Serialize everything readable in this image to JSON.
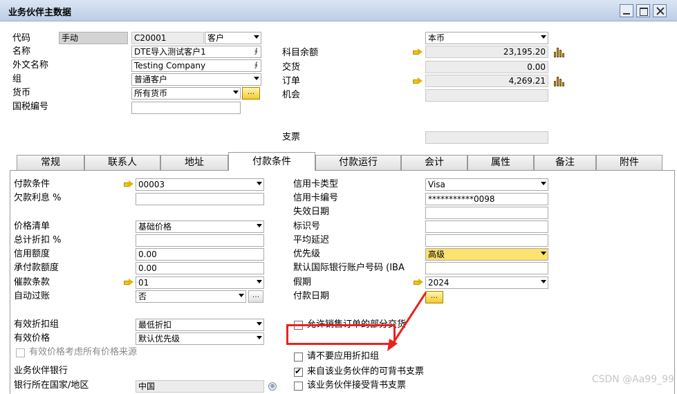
{
  "window": {
    "title": "业务伙伴主数据"
  },
  "header": {
    "code_label": "代码",
    "code_mode": "手动",
    "code_value": "C20001",
    "type_value": "客户",
    "name_label": "名称",
    "name_value": "DTE导入测试客户1",
    "foreign_name_label": "外文名称",
    "foreign_name_value": "Testing Company",
    "group_label": "组",
    "group_value": "普通客户",
    "currency_label": "货币",
    "currency_value": "所有货币",
    "tax_label": "国税编号",
    "tax_value": "",
    "display_currency": "本币",
    "balance_label": "科目余额",
    "balance_value": "23,195.20",
    "delivery_label": "交货",
    "delivery_value": "0.00",
    "orders_label": "订单",
    "orders_value": "4,269.21",
    "opportunity_label": "机会",
    "opportunity_value": "",
    "checks_label": "支票",
    "checks_value": ""
  },
  "tabs": [
    {
      "label": "常规"
    },
    {
      "label": "联系人"
    },
    {
      "label": "地址"
    },
    {
      "label": "付款条件"
    },
    {
      "label": "付款运行"
    },
    {
      "label": "会计"
    },
    {
      "label": "属性"
    },
    {
      "label": "备注"
    },
    {
      "label": "附件"
    }
  ],
  "active_tab": "付款条件",
  "payment": {
    "terms_label": "付款条件",
    "terms_value": "00003",
    "interest_label": "欠款利息 %",
    "interest_value": "",
    "price_list_label": "价格清单",
    "price_list_value": "基础价格",
    "total_discount_label": "总计折扣 %",
    "total_discount_value": "",
    "credit_label": "信用额度",
    "credit_value": "0.00",
    "commitment_label": "承付款额度",
    "commitment_value": "0.00",
    "dunning_label": "催款条款",
    "dunning_value": "01",
    "auto_post_label": "自动过账",
    "auto_post_value": "否",
    "eff_discount_label": "有效折扣组",
    "eff_discount_value": "最低折扣",
    "eff_price_label": "有效价格",
    "eff_price_value": "默认优先级",
    "consider_all_label": "有效价格考虑所有价格来源",
    "bank_section_label": "业务伙伴银行",
    "bank_country_label": "银行所在国家/地区",
    "bank_country_value": "中国",
    "card_type_label": "信用卡类型",
    "card_type_value": "Visa",
    "card_no_label": "信用卡编号",
    "card_no_value": "***********0098",
    "expiry_label": "失效日期",
    "expiry_value": "",
    "id_label": "标识号",
    "id_value": "",
    "avg_delay_label": "平均延迟",
    "avg_delay_value": "",
    "priority_label": "优先级",
    "priority_value": "高级",
    "iban_label": "默认国际银行账户号码 (IBA",
    "iban_value": "",
    "holiday_label": "假期",
    "holiday_value": "2024",
    "pay_date_label": "付款日期",
    "partial_label": "允许销售订单的部分交货",
    "no_discount_label": "请不要应用折扣组",
    "endorse_from_label": "来自该业务伙伴的可背书支票",
    "endorse_accept_label": "该业务伙伴接受背书支票"
  },
  "watermark": "CSDN @Aa99_99",
  "colors": {
    "highlight": "#e8231d",
    "priority_bg": "#fde26f"
  }
}
